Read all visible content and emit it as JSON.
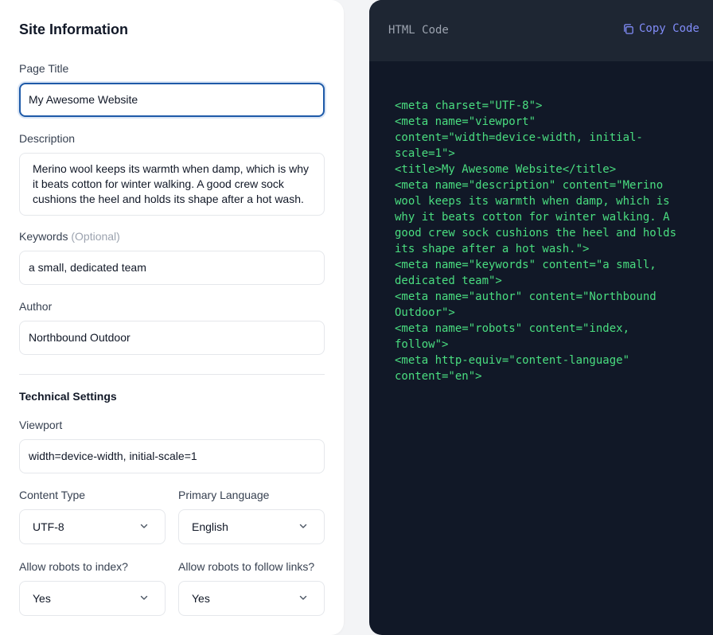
{
  "form": {
    "title": "Site Information",
    "page_title": {
      "label": "Page Title",
      "value": "My Awesome Website"
    },
    "description": {
      "label": "Description",
      "value": "Merino wool keeps its warmth when damp, which is why it beats cotton for winter walking. A good crew sock cushions the heel and holds its shape after a hot wash."
    },
    "keywords": {
      "label": "Keywords",
      "optional": "(Optional)",
      "value": "a small, dedicated team"
    },
    "author": {
      "label": "Author",
      "value": "Northbound Outdoor"
    },
    "technical": {
      "title": "Technical Settings",
      "viewport": {
        "label": "Viewport",
        "value": "width=device-width, initial-scale=1"
      },
      "content_type": {
        "label": "Content Type",
        "value": "UTF-8"
      },
      "language": {
        "label": "Primary Language",
        "value": "English"
      },
      "robots_index": {
        "label": "Allow robots to index?",
        "value": "Yes"
      },
      "robots_follow": {
        "label": "Allow robots to follow links?",
        "value": "Yes"
      }
    }
  },
  "code": {
    "header_title": "HTML Code",
    "copy_label": "Copy Code",
    "lines": [
      "<meta charset=\"UTF-8\">",
      "<meta name=\"viewport\"",
      "content=\"width=device-width, initial-",
      "scale=1\">",
      "<title>My Awesome Website</title>",
      "<meta name=\"description\" content=\"Merino",
      "wool keeps its warmth when damp, which is",
      "why it beats cotton for winter walking. A",
      "good crew sock cushions the heel and holds",
      "its shape after a hot wash.\">",
      "<meta name=\"keywords\" content=\"a small,",
      "dedicated team\">",
      "<meta name=\"author\" content=\"Northbound",
      "Outdoor\">",
      "<meta name=\"robots\" content=\"index,",
      "follow\">",
      "<meta http-equiv=\"content-language\"",
      "content=\"en\">"
    ]
  },
  "icons": {
    "copy": "copy-icon",
    "chevron": "chevron-down-icon"
  },
  "colors": {
    "accent": "#1e5aa8",
    "code_text": "#4ade80",
    "copy_link": "#818cf8",
    "code_bg": "#111827"
  }
}
